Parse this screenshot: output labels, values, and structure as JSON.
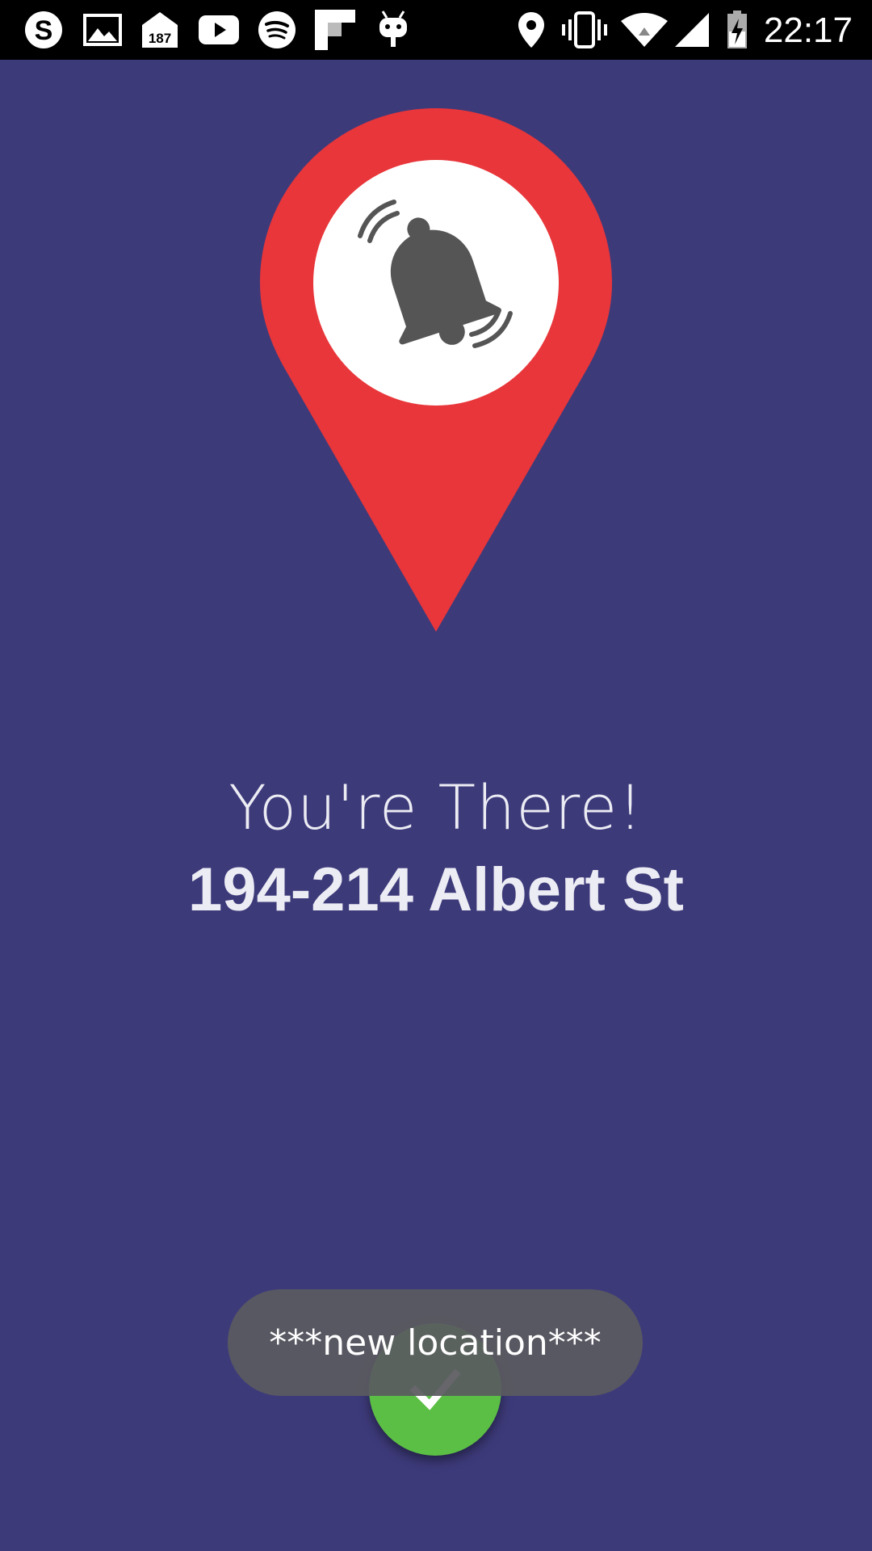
{
  "status_bar": {
    "time": "22:17",
    "notification_badge": "187",
    "left_icons": [
      "skype-icon",
      "gallery-icon",
      "mail-count-icon",
      "youtube-icon",
      "spotify-icon",
      "flipboard-icon",
      "cyanogen-icon"
    ],
    "right_icons": [
      "location-icon",
      "vibrate-icon",
      "wifi-icon",
      "signal-icon",
      "battery-icon"
    ]
  },
  "colors": {
    "background": "#3d3a7a",
    "pin": "#e8363a",
    "bell": "#555555",
    "fab": "#5cbf45",
    "toast": "#5a5a60"
  },
  "main": {
    "title": "You're There!",
    "address": "194-214 Albert St"
  },
  "toast": {
    "message": "***new location***"
  },
  "fab": {
    "icon": "check-icon"
  }
}
